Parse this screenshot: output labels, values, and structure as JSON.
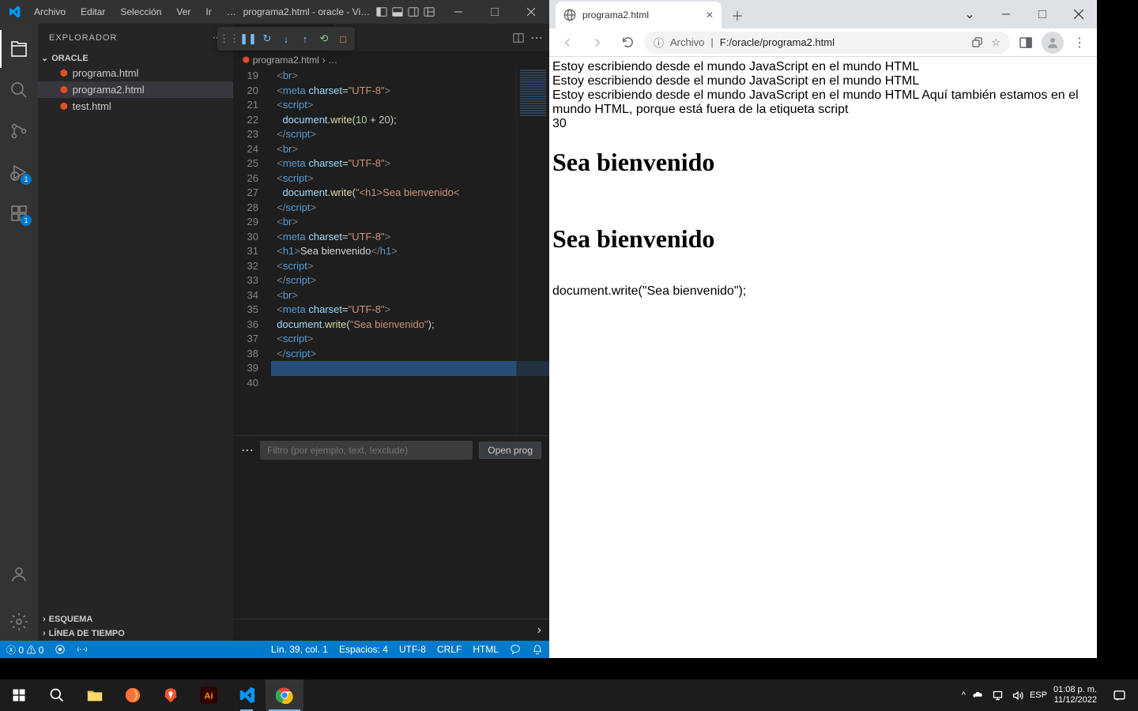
{
  "vscode": {
    "menus": [
      "Archivo",
      "Editar",
      "Selección",
      "Ver",
      "Ir",
      "…"
    ],
    "window_title": "programa2.html - oracle - Vi…",
    "sidebar": {
      "title": "EXPLORADOR",
      "folder": "ORACLE",
      "files": [
        "programa.html",
        "programa2.html",
        "test.html"
      ],
      "sections": [
        "ESQUEMA",
        "LÍNEA DE TIEMPO"
      ]
    },
    "tab_name": "programa2.html",
    "breadcrumb": "programa2.html",
    "breadcrumb_tail": "›  …",
    "line_start": 19,
    "code": [
      {
        "indent": 2,
        "tokens": [
          [
            "tag",
            "<"
          ],
          [
            "name",
            "br"
          ],
          [
            "tag",
            ">"
          ]
        ]
      },
      {
        "indent": 2,
        "tokens": [
          [
            "tag",
            "<"
          ],
          [
            "name",
            "meta"
          ],
          [
            "txt",
            " "
          ],
          [
            "attr",
            "charset"
          ],
          [
            "punct",
            "="
          ],
          [
            "str",
            "\"UTF-8\""
          ],
          [
            "tag",
            ">"
          ]
        ]
      },
      {
        "indent": 2,
        "tokens": [
          [
            "tag",
            "<"
          ],
          [
            "name",
            "script"
          ],
          [
            "tag",
            ">"
          ]
        ]
      },
      {
        "indent": 4,
        "tokens": [
          [
            "obj",
            "document"
          ],
          [
            "punct",
            "."
          ],
          [
            "fn",
            "write"
          ],
          [
            "punct",
            "("
          ],
          [
            "num",
            "10"
          ],
          [
            "txt",
            " "
          ],
          [
            "punct",
            "+"
          ],
          [
            "txt",
            " "
          ],
          [
            "num",
            "20"
          ],
          [
            "punct",
            ")"
          ],
          [
            "punct",
            ";"
          ]
        ]
      },
      {
        "indent": 2,
        "tokens": [
          [
            "tag",
            "</"
          ],
          [
            "name",
            "script"
          ],
          [
            "tag",
            ">"
          ]
        ]
      },
      {
        "indent": 2,
        "tokens": [
          [
            "tag",
            "<"
          ],
          [
            "name",
            "br"
          ],
          [
            "tag",
            ">"
          ]
        ]
      },
      {
        "indent": 2,
        "tokens": [
          [
            "tag",
            "<"
          ],
          [
            "name",
            "meta"
          ],
          [
            "txt",
            " "
          ],
          [
            "attr",
            "charset"
          ],
          [
            "punct",
            "="
          ],
          [
            "str",
            "\"UTF-8\""
          ],
          [
            "tag",
            ">"
          ]
        ]
      },
      {
        "indent": 2,
        "tokens": [
          [
            "tag",
            "<"
          ],
          [
            "name",
            "script"
          ],
          [
            "tag",
            ">"
          ]
        ]
      },
      {
        "indent": 4,
        "tokens": [
          [
            "obj",
            "document"
          ],
          [
            "punct",
            "."
          ],
          [
            "fn",
            "write"
          ],
          [
            "punct",
            "("
          ],
          [
            "str",
            "\"<h1>Sea bienvenido<"
          ]
        ]
      },
      {
        "indent": 2,
        "tokens": [
          [
            "tag",
            "</"
          ],
          [
            "name",
            "script"
          ],
          [
            "tag",
            ">"
          ]
        ]
      },
      {
        "indent": 2,
        "tokens": [
          [
            "tag",
            "<"
          ],
          [
            "name",
            "br"
          ],
          [
            "tag",
            ">"
          ]
        ]
      },
      {
        "indent": 2,
        "tokens": [
          [
            "tag",
            "<"
          ],
          [
            "name",
            "meta"
          ],
          [
            "txt",
            " "
          ],
          [
            "attr",
            "charset"
          ],
          [
            "punct",
            "="
          ],
          [
            "str",
            "\"UTF-8\""
          ],
          [
            "tag",
            ">"
          ]
        ]
      },
      {
        "indent": 2,
        "tokens": [
          [
            "tag",
            "<"
          ],
          [
            "name",
            "h1"
          ],
          [
            "tag",
            ">"
          ],
          [
            "txt",
            "Sea bienvenido"
          ],
          [
            "tag",
            "</"
          ],
          [
            "name",
            "h1"
          ],
          [
            "tag",
            ">"
          ]
        ]
      },
      {
        "indent": 2,
        "tokens": [
          [
            "tag",
            "<"
          ],
          [
            "name",
            "script"
          ],
          [
            "tag",
            ">"
          ]
        ]
      },
      {
        "indent": 2,
        "tokens": [
          [
            "tag",
            "</"
          ],
          [
            "name",
            "script"
          ],
          [
            "tag",
            ">"
          ]
        ]
      },
      {
        "indent": 2,
        "tokens": [
          [
            "tag",
            "<"
          ],
          [
            "name",
            "br"
          ],
          [
            "tag",
            ">"
          ]
        ]
      },
      {
        "indent": 2,
        "tokens": [
          [
            "tag",
            "<"
          ],
          [
            "name",
            "meta"
          ],
          [
            "txt",
            " "
          ],
          [
            "attr",
            "charset"
          ],
          [
            "punct",
            "="
          ],
          [
            "str",
            "\"UTF-8\""
          ],
          [
            "tag",
            ">"
          ]
        ]
      },
      {
        "indent": 2,
        "tokens": [
          [
            "obj",
            "document"
          ],
          [
            "punct",
            "."
          ],
          [
            "fn",
            "write"
          ],
          [
            "punct",
            "("
          ],
          [
            "str",
            "\"Sea bienvenido\""
          ],
          [
            "punct",
            ")"
          ],
          [
            "punct",
            ";"
          ]
        ]
      },
      {
        "indent": 2,
        "tokens": [
          [
            "tag",
            "<"
          ],
          [
            "name",
            "script"
          ],
          [
            "tag",
            ">"
          ]
        ]
      },
      {
        "indent": 2,
        "tokens": [
          [
            "tag",
            "</"
          ],
          [
            "name",
            "script"
          ],
          [
            "tag",
            ">"
          ]
        ]
      },
      {
        "indent": 2,
        "tokens": [],
        "current": true
      },
      {
        "indent": 2,
        "tokens": []
      }
    ],
    "filter_placeholder": "Filtro (por ejemplo, text, !exclude)",
    "open_btn": "Open prog",
    "status": {
      "errors": "0",
      "warnings": "0",
      "ln_col": "Lín. 39, col. 1",
      "spaces": "Espacios: 4",
      "encoding": "UTF-8",
      "eol": "CRLF",
      "lang": "HTML"
    },
    "run_badge": "1",
    "ext_badge": "1"
  },
  "chrome": {
    "tab_title": "programa2.html",
    "url_prefix": "Archivo",
    "url_sep": "|",
    "url": "F:/oracle/programa2.html",
    "page": {
      "line1": "Estoy escribiendo desde el mundo JavaScript en el mundo HTML",
      "line2": "Estoy escribiendo desde el mundo JavaScript en el mundo HTML",
      "line3": "Estoy escribiendo desde el mundo JavaScript en el mundo HTML Aquí también estamos en el mundo HTML, porque está fuera de la etiqueta script",
      "line4": "30",
      "h1a": "Sea bienvenido",
      "h1b": "Sea bienvenido",
      "line5": "document.write(\"Sea bienvenido\");"
    }
  },
  "taskbar": {
    "lang": "ESP",
    "time": "01:08 p. m.",
    "date": "11/12/2022"
  }
}
